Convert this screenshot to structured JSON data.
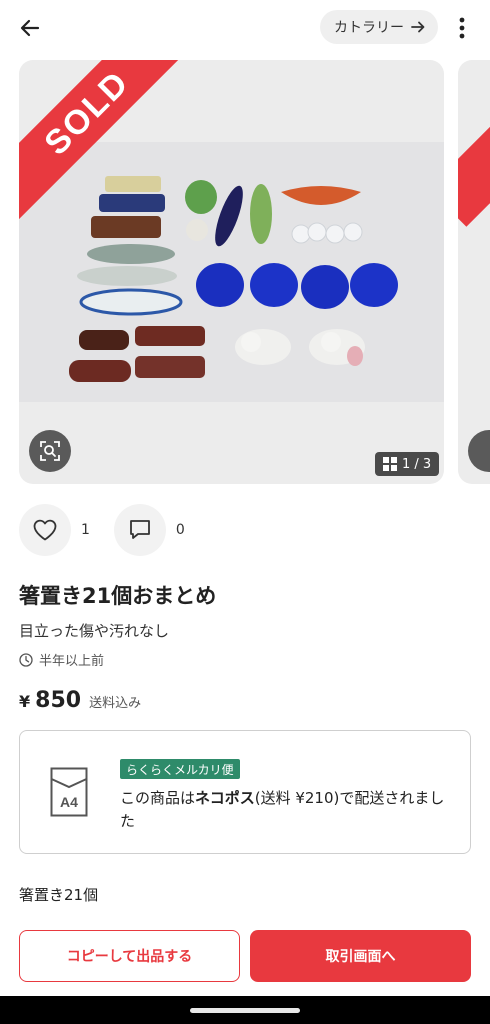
{
  "header": {
    "category_label": "カトラリー"
  },
  "listing": {
    "sold_label": "SOLD",
    "image_counter": "1 / 3",
    "likes_count": "1",
    "comments_count": "0",
    "title": "箸置き21個おまとめ",
    "condition": "目立った傷や汚れなし",
    "posted_time": "半年以上前",
    "price_symbol": "¥",
    "price_value": "850",
    "price_note": "送料込み"
  },
  "shipping": {
    "envelope_label": "A4",
    "badge": "らくらくメルカリ便",
    "text_before": "この商品は",
    "method": "ネコポス",
    "text_after": "(送料 ¥210)で配送されました"
  },
  "description": {
    "line1": "箸置き21個"
  },
  "buttons": {
    "copy_listing": "コピーして出品する",
    "trade_screen": "取引画面へ"
  },
  "colors": {
    "accent": "#e8393f",
    "badge_green": "#2e8b6a"
  }
}
